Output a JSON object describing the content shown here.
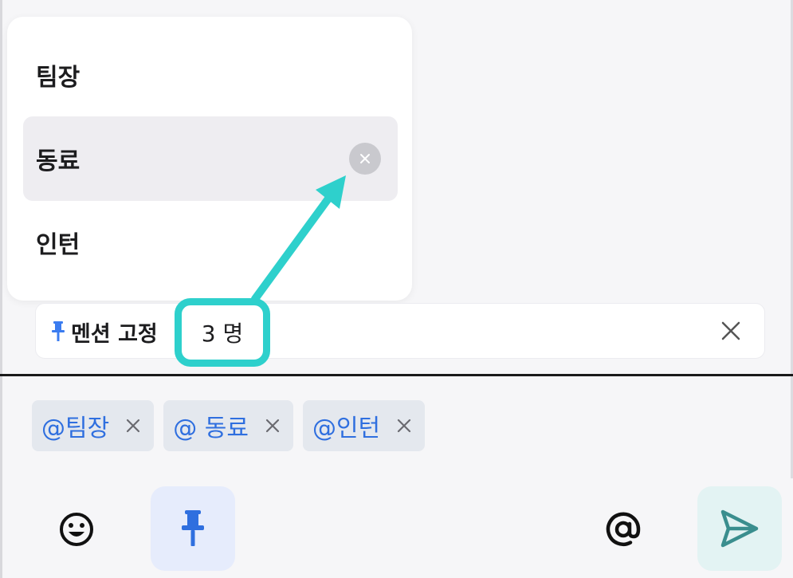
{
  "popup": {
    "items": [
      {
        "label": "팀장"
      },
      {
        "label": "동료",
        "highlighted": true
      },
      {
        "label": "인턴"
      }
    ]
  },
  "mention_bar": {
    "label": "멘션 고정",
    "count": "3 명"
  },
  "chips": [
    {
      "label": "@팀장"
    },
    {
      "label": "@ 동료"
    },
    {
      "label": "@인턴"
    }
  ],
  "icons": {
    "emoji": "smiley-icon",
    "pin": "pin-icon",
    "at": "at-sign-icon",
    "send": "send-icon",
    "close": "close-icon"
  },
  "colors": {
    "accent_blue": "#2f6fdf",
    "highlight_teal": "#2ed0cc",
    "send_teal": "#3a8e8e"
  }
}
